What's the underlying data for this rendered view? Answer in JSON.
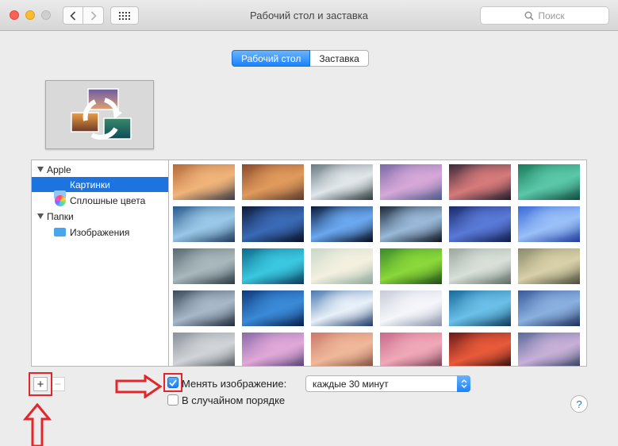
{
  "window": {
    "title": "Рабочий стол и заставка",
    "search_placeholder": "Поиск"
  },
  "tabs": [
    {
      "label": "Рабочий стол",
      "active": true
    },
    {
      "label": "Заставка",
      "active": false
    }
  ],
  "sidebar": {
    "groups": [
      {
        "label": "Apple",
        "items": [
          {
            "label": "Картинки",
            "icon": "folder-icon",
            "selected": true
          },
          {
            "label": "Сплошные цвета",
            "icon": "color-wheel-icon",
            "selected": false
          }
        ]
      },
      {
        "label": "Папки",
        "items": [
          {
            "label": "Изображения",
            "icon": "pictures-folder-icon",
            "selected": false
          }
        ]
      }
    ]
  },
  "wallpapers": [
    [
      "#b46a3c",
      "#f0b47a",
      "#3a3a46"
    ],
    [
      "#8b4a2c",
      "#e09a5c",
      "#5a3a2a"
    ],
    [
      "#6a7a82",
      "#e0e6ea",
      "#2c3a3a"
    ],
    [
      "#7a6aa6",
      "#d6a8d8",
      "#4a5a8a"
    ],
    [
      "#3a2a3a",
      "#d67a7a",
      "#1e1a2a"
    ],
    [
      "#1a7a5a",
      "#5ac8a8",
      "#0e4a3e"
    ],
    [
      "#2a5a8a",
      "#9ac8e8",
      "#1e3a5a"
    ],
    [
      "#0e1a3a",
      "#3a6ab6",
      "#060e20"
    ],
    [
      "#0a1a3a",
      "#6aa8f0",
      "#04081a"
    ],
    [
      "#1a2a3a",
      "#9ab8d8",
      "#0a121e"
    ],
    [
      "#1a2a6a",
      "#5a7ad8",
      "#0e1a4a"
    ],
    [
      "#3a6ad8",
      "#9ac0f8",
      "#1e3a9a"
    ],
    [
      "#5a6a72",
      "#a8b8bc",
      "#2a3a42"
    ],
    [
      "#0e6a8a",
      "#3ac8e0",
      "#083a5a"
    ],
    [
      "#c8d8c8",
      "#f4f0e0",
      "#8aa89a"
    ],
    [
      "#3a8a2a",
      "#8ad83a",
      "#1e4a16"
    ],
    [
      "#9aa8a0",
      "#d8e0d8",
      "#5a6a62"
    ],
    [
      "#8a8a6a",
      "#d8d0a8",
      "#4a4a3a"
    ],
    [
      "#3a4a5a",
      "#a8b8c8",
      "#1e2a3a"
    ],
    [
      "#0e3a7a",
      "#3a8ad8",
      "#061e4a"
    ],
    [
      "#4a7ab0",
      "#e8f0f8",
      "#1e3a6a"
    ],
    [
      "#c8ccd8",
      "#f4f6fa",
      "#8a92a8"
    ],
    [
      "#1a6a9a",
      "#6ac0e8",
      "#0e3a5a"
    ],
    [
      "#3a5a9a",
      "#8ab0e0",
      "#1e2e5a"
    ],
    [
      "#8a9098",
      "#d0d4d8",
      "#4a5058"
    ],
    [
      "#8a6aa8",
      "#e0a8d8",
      "#4a3a6a"
    ],
    [
      "#c87a6a",
      "#f0b89a",
      "#7a4a3a"
    ],
    [
      "#c86a8a",
      "#f0a8b8",
      "#6a3a4a"
    ],
    [
      "#6a1a1a",
      "#e85a3a",
      "#2a0a0a"
    ],
    [
      "#5a6a9a",
      "#c8b0d8",
      "#2a3a5a"
    ]
  ],
  "controls": {
    "add_label": "+",
    "remove_label": "−",
    "change_picture_label": "Менять изображение:",
    "change_picture_checked": true,
    "interval_value": "каждые 30 минут",
    "random_order_label": "В случайном порядке",
    "random_order_checked": false,
    "help_label": "?"
  },
  "colors": {
    "accent": "#1d74e0",
    "annotation_red": "#e3262b"
  }
}
